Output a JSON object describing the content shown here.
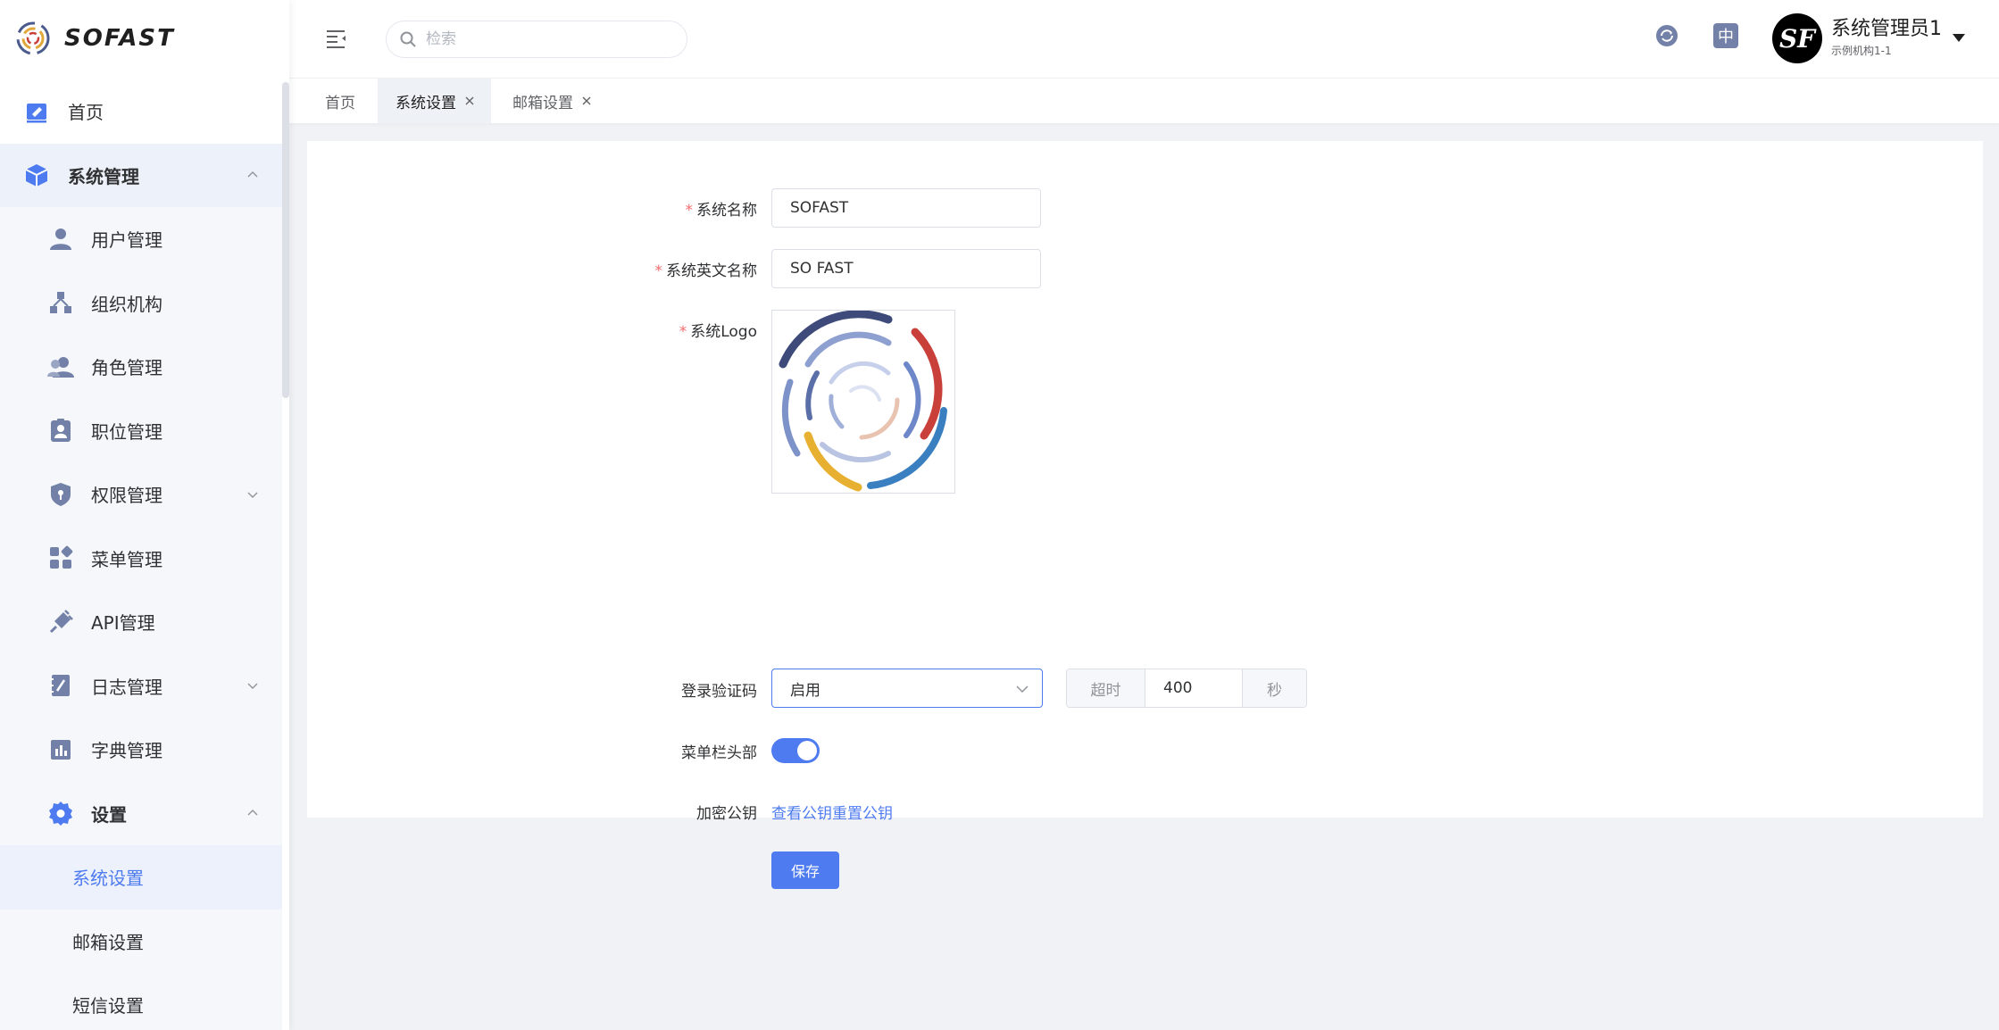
{
  "app": {
    "logo_text": "SOFAST"
  },
  "sidebar": {
    "items": [
      {
        "label": "首页",
        "icon": "edit-icon"
      },
      {
        "label": "系统管理",
        "icon": "cube-icon"
      },
      {
        "label": "用户管理",
        "icon": "user-icon"
      },
      {
        "label": "组织机构",
        "icon": "org-icon"
      },
      {
        "label": "角色管理",
        "icon": "users-icon"
      },
      {
        "label": "职位管理",
        "icon": "badge-icon"
      },
      {
        "label": "权限管理",
        "icon": "shield-icon"
      },
      {
        "label": "菜单管理",
        "icon": "grid-icon"
      },
      {
        "label": "API管理",
        "icon": "plug-icon"
      },
      {
        "label": "日志管理",
        "icon": "log-icon"
      },
      {
        "label": "字典管理",
        "icon": "dict-icon"
      },
      {
        "label": "设置",
        "icon": "gear-icon"
      },
      {
        "label": "系统设置"
      },
      {
        "label": "邮箱设置"
      },
      {
        "label": "短信设置"
      }
    ]
  },
  "header": {
    "search_placeholder": "检索",
    "user_name": "系统管理员1",
    "user_org": "示例机构1-1",
    "avatar_text": "SF",
    "lang_label": "中"
  },
  "tabs": [
    {
      "label": "首页"
    },
    {
      "label": "系统设置"
    },
    {
      "label": "邮箱设置"
    }
  ],
  "form": {
    "system_name_label": "系统名称",
    "system_name_value": "SOFAST",
    "system_en_name_label": "系统英文名称",
    "system_en_name_value": "SO FAST",
    "system_logo_label": "系统Logo",
    "captcha_label": "登录验证码",
    "captcha_value": "启用",
    "timeout_prefix": "超时",
    "timeout_value": "400",
    "timeout_suffix": "秒",
    "menu_header_label": "菜单栏头部",
    "menu_header_enabled": true,
    "public_key_label": "加密公钥",
    "view_key_link": "查看公钥",
    "reset_key_link": "重置公钥",
    "save_button": "保存"
  },
  "colors": {
    "primary": "#4e7bf0",
    "icon": "#7381a8",
    "required": "#f56c6c"
  }
}
